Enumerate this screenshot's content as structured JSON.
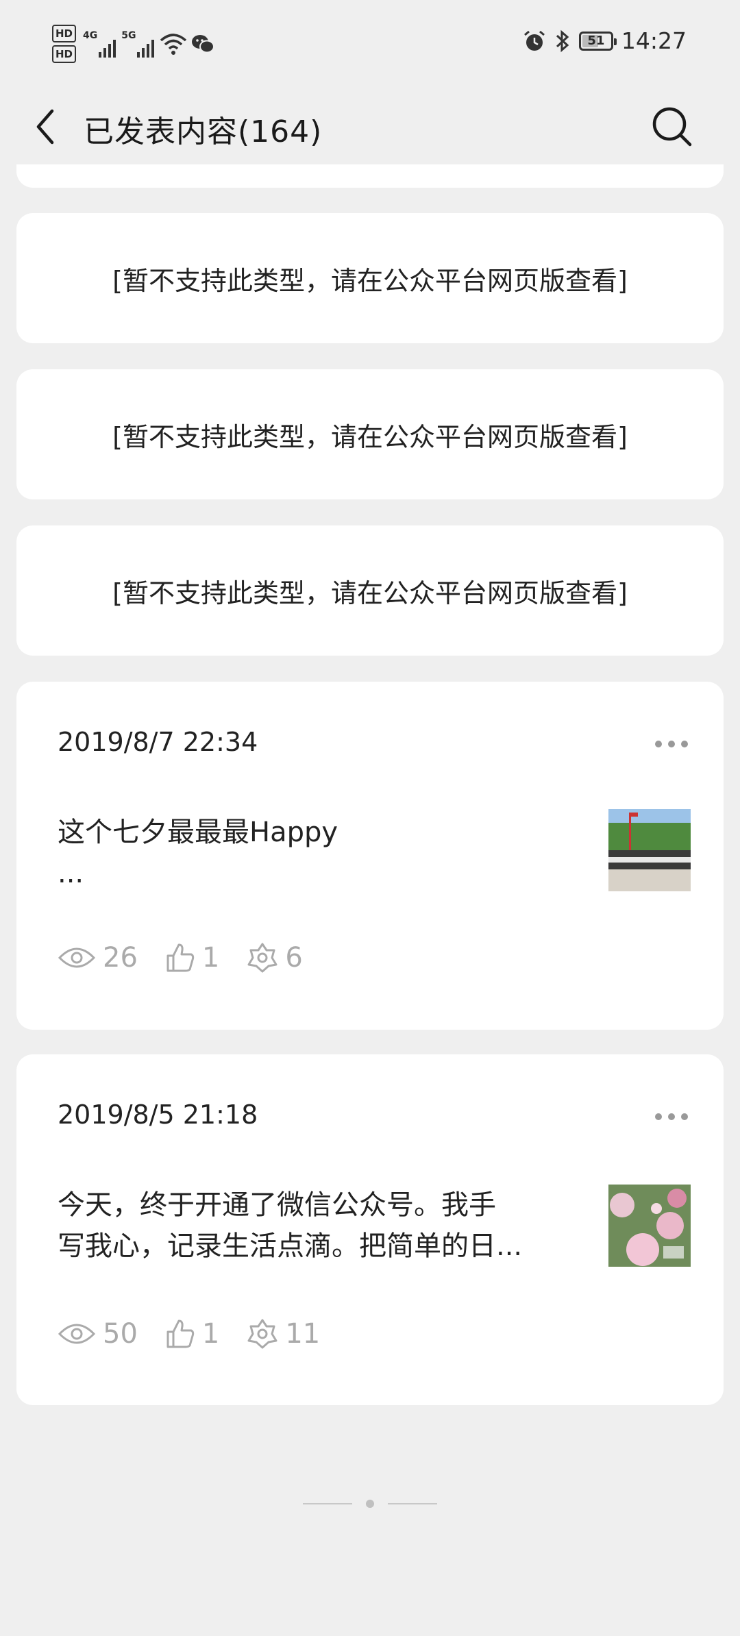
{
  "status": {
    "hd1": "HD",
    "hd2": "HD",
    "net1": "4G",
    "net2": "5G",
    "battery": "51",
    "time": "14:27",
    "icons": [
      "signal-icon",
      "wifi-icon",
      "wechat-icon",
      "alarm-icon",
      "bluetooth-icon",
      "battery-icon"
    ]
  },
  "header": {
    "title": "已发表内容(164)"
  },
  "unsupported_text": "[暂不支持此类型，请在公众平台网页版查看]",
  "articles": [
    {
      "date": "2019/8/7 22:34",
      "summary_line1": "这个七夕最最最Happy",
      "summary_line2": "...",
      "views": "26",
      "likes": "1",
      "shares": "6"
    },
    {
      "date": "2019/8/5 21:18",
      "summary_line1": "今天，终于开通了微信公众号。我手",
      "summary_line2": "写我心，记录生活点滴。把简单的日...",
      "views": "50",
      "likes": "1",
      "shares": "11"
    }
  ],
  "colors": {
    "background": "#efefef",
    "card": "#ffffff",
    "text": "#222222",
    "muted": "#aaaaaa"
  }
}
